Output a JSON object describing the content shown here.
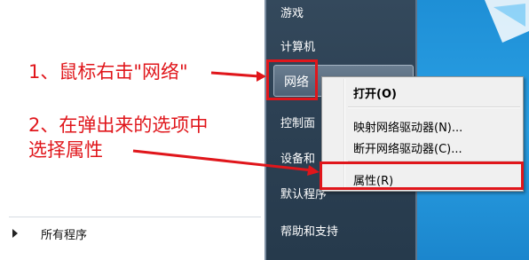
{
  "start_menu": {
    "right_items": [
      "游戏",
      "计算机",
      "网络",
      "控制面",
      "设备和",
      "默认程序",
      "帮助和支持"
    ],
    "all_programs_label": "所有程序"
  },
  "context_menu": {
    "open": "打开(O)",
    "map_drive": "映射网络驱动器(N)...",
    "disconnect_drive": "断开网络驱动器(C)...",
    "properties": "属性(R)"
  },
  "annotations": {
    "step1": "1、鼠标右击\"网络\"",
    "step2_line1": "2、在弹出来的选项中",
    "step2_line2": "选择属性"
  },
  "colors": {
    "annotation_red": "#e0161b",
    "start_right_pane": "#2d4154",
    "desktop_blue": "#1e8fd6"
  }
}
